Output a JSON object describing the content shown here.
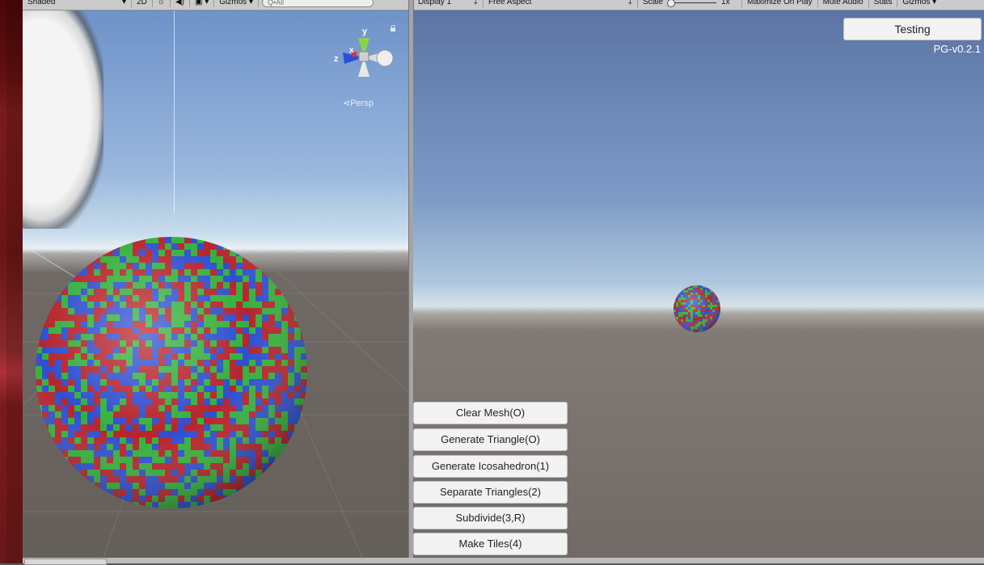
{
  "scene_toolbar": {
    "shading_mode": "Shaded",
    "mode_2d": "2D",
    "gizmos_label": "Gizmos",
    "search_placeholder": "Q•All"
  },
  "game_toolbar": {
    "display": "Display 1",
    "aspect": "Free Aspect",
    "scale_label": "Scale",
    "scale_value": "1x",
    "maximize_on_play": "Maximize On Play",
    "mute_audio": "Mute Audio",
    "stats": "Stats",
    "gizmos_label": "Gizmos"
  },
  "scene_view": {
    "projection_label": "Persp",
    "gizmo_axes": {
      "y": "y",
      "x": "x",
      "z": "z"
    }
  },
  "game_view": {
    "top_button": "Testing",
    "version": "PG-v0.2.1",
    "buttons": [
      "Clear Mesh(O)",
      "Generate Triangle(O)",
      "Generate Icosahedron(1)",
      "Separate Triangles(2)",
      "Subdivide(3,R)",
      "Make Tiles(4)"
    ]
  },
  "colors": {
    "tile_red": "#b7242c",
    "tile_green": "#34b03c",
    "tile_blue": "#2f4fd0"
  }
}
